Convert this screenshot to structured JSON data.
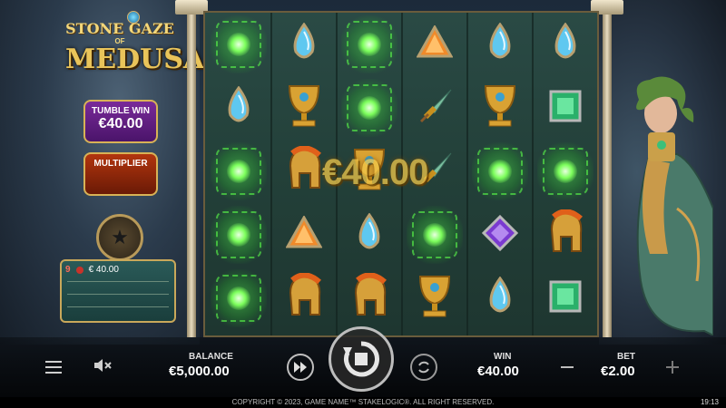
{
  "game": {
    "logo_line1": "STONE GAZE",
    "logo_line2": "OF",
    "logo_main": "MEDUSA"
  },
  "tumble_win": {
    "label": "TUMBLE WIN",
    "value": "€40.00"
  },
  "multiplier": {
    "label": "MULTIPLIER"
  },
  "history": {
    "count": "9",
    "amount": "€ 40.00"
  },
  "win_overlay": "€40.00",
  "hud": {
    "balance_label": "BALANCE",
    "balance_value": "€5,000.00",
    "win_label": "WIN",
    "win_value": "€40.00",
    "bet_label": "BET",
    "bet_value": "€2.00"
  },
  "footer": {
    "copyright": "COPYRIGHT © 2023, GAME NAME™ STAKELOGIC®. ALL RIGHT RESERVED.",
    "clock": "19:13"
  },
  "grid": [
    [
      "win",
      "blue-gem",
      "win",
      "orange-gem",
      "blue-gem",
      "blue-gem"
    ],
    [
      "blue-gem",
      "gold-cup",
      "win",
      "dagger",
      "gold-cup",
      "green-gem"
    ],
    [
      "win",
      "helmet",
      "gold-cup",
      "dagger",
      "win",
      "win"
    ],
    [
      "win",
      "orange-gem",
      "blue-gem",
      "win",
      "purple-gem",
      "helmet"
    ],
    [
      "win",
      "helmet",
      "helmet",
      "gold-cup",
      "blue-gem",
      "green-gem"
    ]
  ],
  "colors": {
    "accent": "#d8b256",
    "win_glow": "#5cff4a",
    "tumble_bg": "#6a1f8a",
    "multiplier_bg": "#a12f0c"
  }
}
